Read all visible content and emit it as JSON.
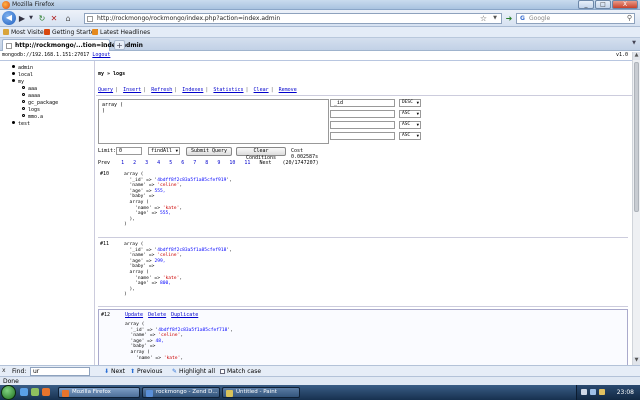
{
  "window": {
    "title": "Mozilla Firefox",
    "min": "_",
    "max": "□",
    "close": "X"
  },
  "nav": {
    "back": "◀",
    "forward": "▶",
    "history_dropdown": "▼",
    "reload": "↻",
    "stop": "✕",
    "home": "⌂",
    "url": "http://rockmongo/rockmongo/index.php?action=index.admin",
    "star": "☆",
    "url_dropdown": "▼",
    "go": "➜",
    "search_engine": "G",
    "search_placeholder": "Google",
    "search_icon": "⚲"
  },
  "bookmarks": [
    {
      "label": "Most Visited",
      "color": "#d9a43a"
    },
    {
      "label": "Getting Started",
      "color": "#d9480f"
    },
    {
      "label": "Latest Headlines",
      "color": "#e58a1f"
    }
  ],
  "tabs": {
    "active_label": "http://rockmongo/...tion=index.admin",
    "close": "x",
    "new_tab": "+",
    "list": "▼"
  },
  "page": {
    "server_prefix": "mongodb://192.168.1.151:27017",
    "logout": "Logout",
    "version": "v1.0",
    "tree": [
      {
        "label": "admin",
        "level": 0
      },
      {
        "label": "local",
        "level": 0
      },
      {
        "label": "my",
        "level": 0
      },
      {
        "label": "aaa",
        "level": 1
      },
      {
        "label": "aaaa",
        "level": 1
      },
      {
        "label": "gc_package",
        "level": 1
      },
      {
        "label": "logs",
        "level": 1
      },
      {
        "label": "mmo.a",
        "level": 1
      },
      {
        "label": "test",
        "level": 0
      }
    ],
    "breadcrumb": "my » logs",
    "menu": [
      "Query",
      "Insert",
      "Refresh",
      "Indexes",
      "Statistics",
      "Clear",
      "Remove"
    ],
    "query_text": "array (\n)",
    "sort_fields": [
      {
        "field": "_id",
        "order": "DESC"
      },
      {
        "field": "",
        "order": "ASC"
      },
      {
        "field": "",
        "order": "ASC"
      },
      {
        "field": "",
        "order": "ASC"
      }
    ],
    "limit_label": "Limit:",
    "limit_value": "0",
    "action_value": "findAll",
    "submit_label": "Submit Query",
    "clear_label": "Clear Conditions",
    "cost": "Cost 0.002587s",
    "pager": {
      "prev": "Prev",
      "pages": [
        "1",
        "2",
        "3",
        "4",
        "5",
        "6",
        "7",
        "8",
        "9",
        "10",
        "11"
      ],
      "next": "Next",
      "total": "(20/1747207)"
    },
    "records": [
      {
        "num": "#10",
        "id": "4bdff8f2c83a5f1a85cfef919",
        "name": "'celine'",
        "age": "555,",
        "age2": "555,",
        "actions": []
      },
      {
        "num": "#11",
        "id": "4bdff8f2c83a5f1a85cfef918",
        "name": "'celine'",
        "age": "299,",
        "age2": "800,",
        "actions": []
      },
      {
        "num": "#12",
        "id": "4bdff8f2c83a5f1a85cfef718",
        "name": "'celine'",
        "age": "48,",
        "age2": "",
        "actions": [
          "Update",
          "Delete",
          "Duplicate"
        ]
      }
    ]
  },
  "findbar": {
    "close": "x",
    "label": "Find:",
    "value": "ur",
    "next": "Next",
    "previous": "Previous",
    "highlight": "Highlight all",
    "match_case": "Match case"
  },
  "status": "Done",
  "taskbar": {
    "tasks": [
      {
        "label": "Mozilla Firefox",
        "color": "#e8742c"
      },
      {
        "label": "rockmongo - Zend D...",
        "color": "#5a8fd8"
      },
      {
        "label": "Untitled - Paint",
        "color": "#d8c25a"
      }
    ],
    "clock": "23:08"
  }
}
